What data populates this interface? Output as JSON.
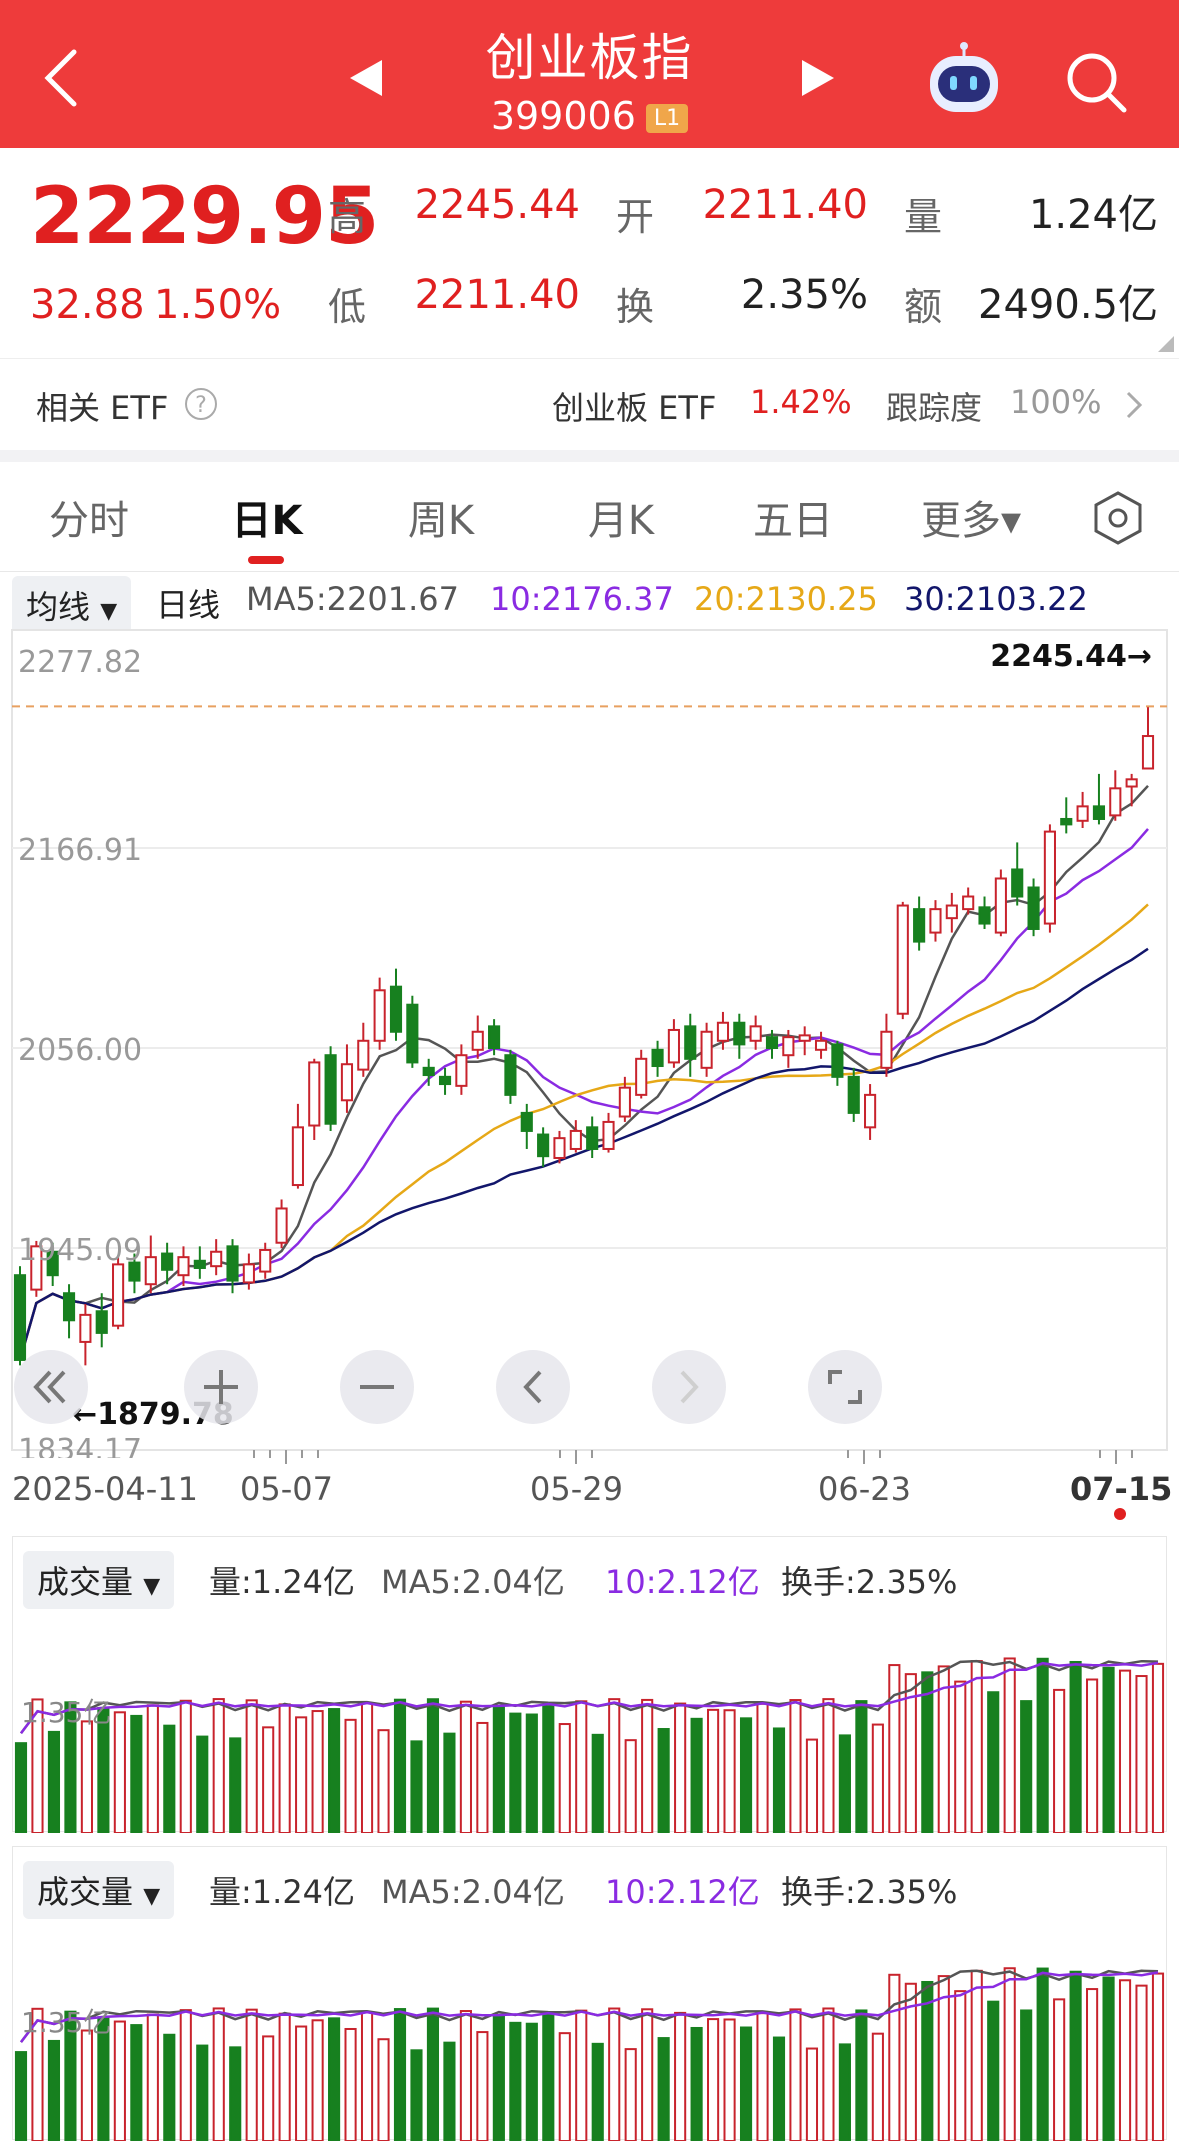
{
  "header": {
    "title": "创业板指",
    "code": "399006",
    "level_badge": "L1",
    "bg_color": "#ee3b3b"
  },
  "quote": {
    "price": "2229.95",
    "change": "32.88",
    "change_pct": "1.50%",
    "high_label": "高",
    "high": "2245.44",
    "open_label": "开",
    "open": "2211.40",
    "volume_label": "量",
    "volume": "1.24亿",
    "low_label": "低",
    "low": "2211.40",
    "turnover_label": "换",
    "turnover": "2.35%",
    "amount_label": "额",
    "amount": "2490.5亿"
  },
  "etf": {
    "label": "相关 ETF",
    "name": "创业板 ETF",
    "pct": "1.42%",
    "track_label": "跟踪度",
    "track_value": "100%"
  },
  "tabs": [
    "分时",
    "日K",
    "周K",
    "月K",
    "五日",
    "更多▾"
  ],
  "active_tab_index": 1,
  "ma_row": {
    "select": "均线",
    "period": "日线",
    "ma5": "MA5:2201.67",
    "ma10": "10:2176.37",
    "ma20": "20:2130.25",
    "ma30": "30:2103.22"
  },
  "colors": {
    "up": "#c8232c",
    "down": "#17801f",
    "ma5": "#555555",
    "ma10": "#8a2be2",
    "ma20": "#e6a817",
    "ma30": "#12166b",
    "accent": "#e02020"
  },
  "chart_data": {
    "type": "candlestick",
    "y_tick_labels": [
      "2277.82",
      "2166.91",
      "2056.00",
      "1945.09",
      "1834.17"
    ],
    "ylim": [
      1834.17,
      2277.82
    ],
    "high_marker": "2245.44→",
    "low_marker": "←1879.78",
    "x_tick_labels": [
      "2025-04-11",
      "05-07",
      "05-29",
      "06-23",
      "07-15"
    ],
    "candles": [
      [
        1930,
        1883,
        1935,
        1880
      ],
      [
        1922,
        1946,
        1949,
        1918
      ],
      [
        1943,
        1930,
        1948,
        1924
      ],
      [
        1920,
        1905,
        1925,
        1895
      ],
      [
        1893,
        1908,
        1914,
        1880
      ],
      [
        1910,
        1898,
        1920,
        1890
      ],
      [
        1902,
        1936,
        1940,
        1900
      ],
      [
        1937,
        1927,
        1942,
        1920
      ],
      [
        1925,
        1940,
        1952,
        1920
      ],
      [
        1942,
        1933,
        1948,
        1925
      ],
      [
        1930,
        1940,
        1946,
        1924
      ],
      [
        1938,
        1934,
        1946,
        1928
      ],
      [
        1935,
        1943,
        1950,
        1930
      ],
      [
        1946,
        1927,
        1950,
        1920
      ],
      [
        1926,
        1936,
        1942,
        1922
      ],
      [
        1932,
        1944,
        1948,
        1928
      ],
      [
        1948,
        1967,
        1972,
        1945
      ],
      [
        1980,
        2012,
        2025,
        1978
      ],
      [
        2013,
        2048,
        2050,
        2005
      ],
      [
        2052,
        2014,
        2057,
        2010
      ],
      [
        2027,
        2047,
        2058,
        2020
      ],
      [
        2044,
        2060,
        2070,
        2040
      ],
      [
        2060,
        2088,
        2095,
        2055
      ],
      [
        2090,
        2065,
        2100,
        2060
      ],
      [
        2080,
        2048,
        2085,
        2045
      ],
      [
        2045,
        2041,
        2050,
        2035
      ],
      [
        2040,
        2036,
        2045,
        2030
      ],
      [
        2035,
        2052,
        2058,
        2030
      ],
      [
        2055,
        2065,
        2074,
        2050
      ],
      [
        2068,
        2056,
        2072,
        2052
      ],
      [
        2052,
        2030,
        2055,
        2025
      ],
      [
        2020,
        2010,
        2025,
        2000
      ],
      [
        2008,
        1996,
        2012,
        1990
      ],
      [
        1995,
        2006,
        2010,
        1992
      ],
      [
        2000,
        2010,
        2016,
        1998
      ],
      [
        2012,
        2000,
        2018,
        1995
      ],
      [
        2000,
        2015,
        2020,
        1998
      ],
      [
        2018,
        2034,
        2040,
        2015
      ],
      [
        2030,
        2050,
        2055,
        2028
      ],
      [
        2055,
        2046,
        2060,
        2040
      ],
      [
        2048,
        2066,
        2072,
        2045
      ],
      [
        2068,
        2050,
        2075,
        2040
      ],
      [
        2045,
        2065,
        2070,
        2040
      ],
      [
        2060,
        2070,
        2076,
        2055
      ],
      [
        2070,
        2058,
        2075,
        2050
      ],
      [
        2060,
        2068,
        2074,
        2055
      ],
      [
        2062,
        2056,
        2066,
        2050
      ],
      [
        2052,
        2062,
        2066,
        2045
      ],
      [
        2060,
        2063,
        2068,
        2052
      ],
      [
        2055,
        2060,
        2065,
        2050
      ],
      [
        2058,
        2040,
        2060,
        2035
      ],
      [
        2040,
        2020,
        2045,
        2015
      ],
      [
        2012,
        2030,
        2036,
        2005
      ],
      [
        2045,
        2065,
        2075,
        2040
      ],
      [
        2075,
        2135,
        2137,
        2072
      ],
      [
        2133,
        2115,
        2140,
        2110
      ],
      [
        2120,
        2133,
        2138,
        2115
      ],
      [
        2128,
        2135,
        2142,
        2120
      ],
      [
        2133,
        2140,
        2145,
        2130
      ],
      [
        2134,
        2125,
        2140,
        2122
      ],
      [
        2120,
        2150,
        2155,
        2118
      ],
      [
        2155,
        2140,
        2170,
        2135
      ],
      [
        2145,
        2122,
        2150,
        2118
      ],
      [
        2125,
        2176,
        2180,
        2120
      ],
      [
        2183,
        2180,
        2195,
        2175
      ],
      [
        2182,
        2190,
        2198,
        2178
      ],
      [
        2190,
        2183,
        2208,
        2180
      ],
      [
        2185,
        2200,
        2210,
        2182
      ],
      [
        2201,
        2205,
        2208,
        2190
      ],
      [
        2211,
        2229,
        2245,
        2211
      ]
    ]
  },
  "volume_panel": {
    "select": "成交量",
    "vol": "量:1.24亿",
    "ma5": "MA5:2.04亿",
    "ma10": "10:2.12亿",
    "turnover": "换手:2.35%",
    "axis_label": "1.35亿"
  }
}
